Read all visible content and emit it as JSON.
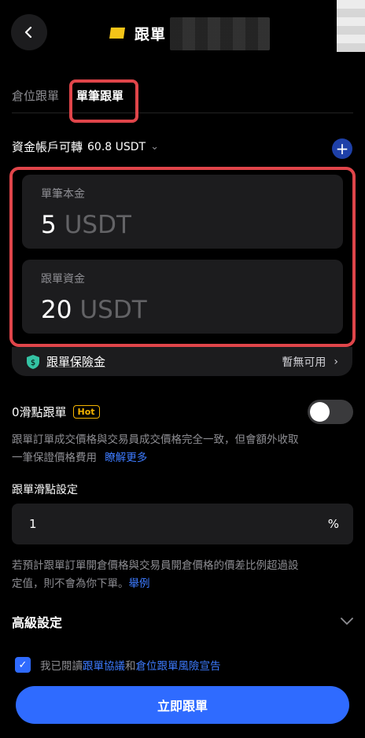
{
  "header": {
    "title": "跟單"
  },
  "tabs": [
    {
      "label": "倉位跟單"
    },
    {
      "label": "單筆跟單"
    }
  ],
  "balance": {
    "label": "資金帳戶可轉",
    "value": "60.8 USDT"
  },
  "amount_per_trade": {
    "label": "單筆本金",
    "value": "5",
    "unit": "USDT"
  },
  "copy_funds": {
    "label": "跟單資金",
    "value": "20",
    "unit": "USDT"
  },
  "insurance": {
    "label": "跟單保險金",
    "status": "暫無可用"
  },
  "slippage": {
    "label": "0滑點跟單",
    "badge": "Hot",
    "toggle_on": false,
    "desc_line1": "跟單訂單成交價格與交易員成交價格完全一致，但會額外收取",
    "desc_line2": "一筆保證價格費用",
    "learn_more": "瞭解更多"
  },
  "slippage_setting": {
    "label": "跟單滑點設定",
    "value": "1",
    "unit": "%",
    "desc_line1": "若預計跟單訂單開倉價格與交易員開倉價格的價差比例超過設",
    "desc_line2": "定值，則不會為你下單。",
    "example": "舉例"
  },
  "advanced": {
    "label": "高級設定"
  },
  "agreement": {
    "prefix": "我已閱讀",
    "link1": "跟單協議",
    "mid": "和",
    "link2": "倉位跟單風險宣告",
    "checked": true
  },
  "submit": {
    "label": "立即跟單"
  },
  "colors": {
    "accent": "#2f6bff",
    "highlight_box": "#e0454a",
    "hot": "#f5b400"
  },
  "icons": [
    "back-arrow-icon",
    "logo-icon",
    "chevron-down-icon",
    "plus-icon",
    "shield-icon",
    "chevron-right-icon",
    "check-icon"
  ]
}
